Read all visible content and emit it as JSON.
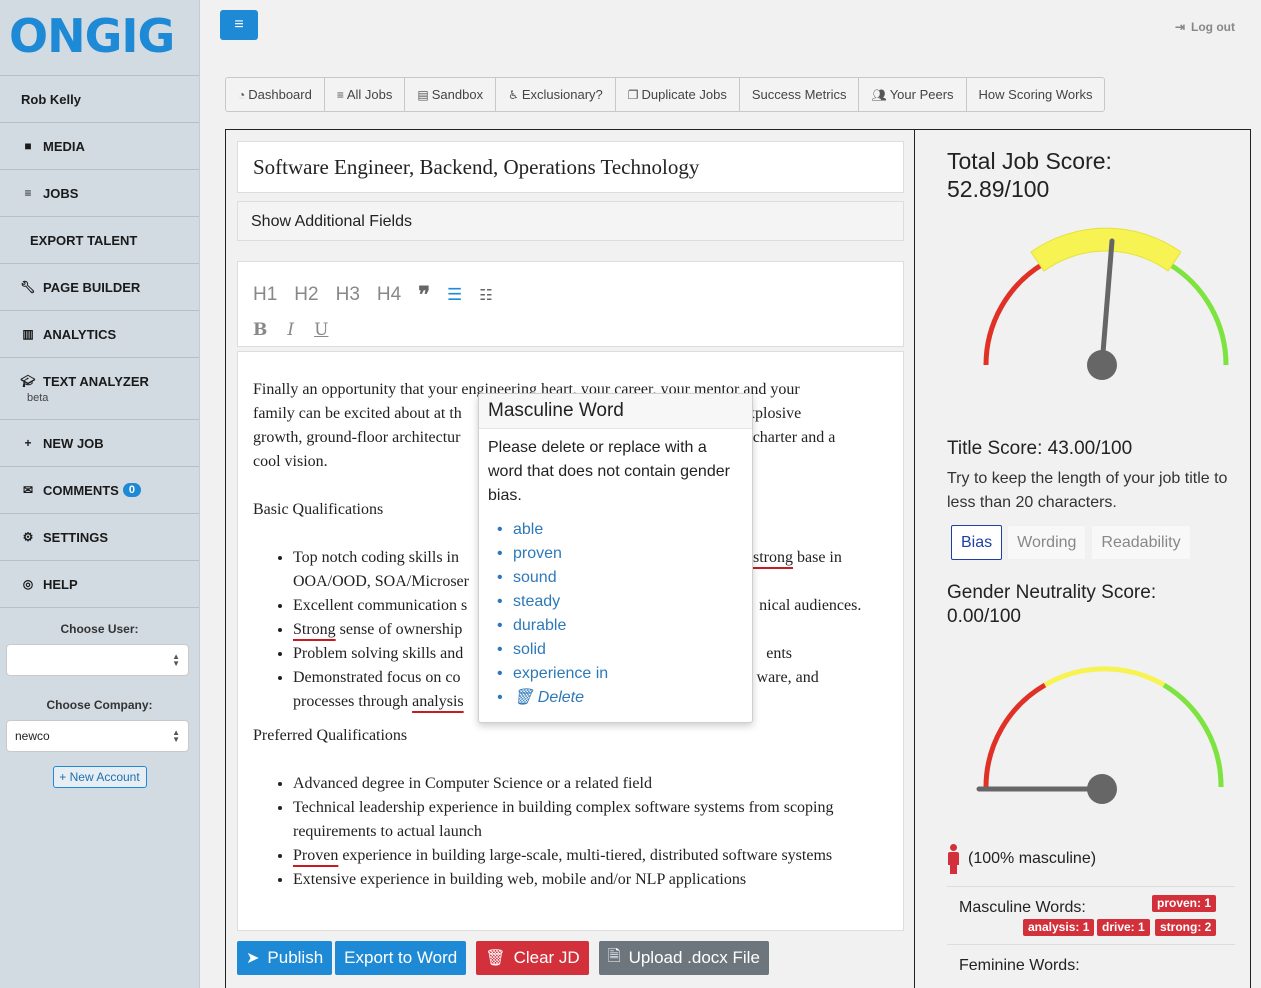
{
  "logo": "ONGIG",
  "sidebar": {
    "user_name": "Rob Kelly",
    "items": [
      {
        "label": "MEDIA",
        "icon": "video-camera-icon"
      },
      {
        "label": "JOBS",
        "icon": "list-icon"
      },
      {
        "label": "EXPORT TALENT",
        "icon": ""
      },
      {
        "label": "PAGE BUILDER",
        "icon": "wrench-icon"
      },
      {
        "label": "ANALYTICS",
        "icon": "bar-chart-icon"
      },
      {
        "label": "TEXT ANALYZER",
        "icon": "graduation-cap-icon",
        "sub": "beta"
      },
      {
        "label": "NEW JOB",
        "icon": "plus-icon"
      },
      {
        "label": "COMMENTS",
        "icon": "envelope-icon",
        "badge": "0"
      },
      {
        "label": "SETTINGS",
        "icon": "gear-icon"
      },
      {
        "label": "HELP",
        "icon": "life-ring-icon"
      }
    ],
    "choose_user_label": "Choose User:",
    "choose_user_value": "",
    "choose_company_label": "Choose Company:",
    "choose_company_value": "newco",
    "new_account_label": "New Account"
  },
  "header": {
    "logout_label": "Log out"
  },
  "nav": [
    {
      "label": "Dashboard",
      "icon": "dashboard-icon"
    },
    {
      "label": "All Jobs",
      "icon": "list-icon"
    },
    {
      "label": "Sandbox",
      "icon": "newspaper-icon"
    },
    {
      "label": "Exclusionary?",
      "icon": "wheelchair-icon"
    },
    {
      "label": "Duplicate Jobs",
      "icon": "copy-icon"
    },
    {
      "label": "Success Metrics",
      "icon": ""
    },
    {
      "label": "Your Peers",
      "icon": "users-icon"
    },
    {
      "label": "How Scoring Works",
      "icon": ""
    }
  ],
  "editor": {
    "job_title": "Software Engineer, Backend, Operations Technology",
    "additional_fields": "Show Additional Fields",
    "toolbar": {
      "h1": "H1",
      "h2": "H2",
      "h3": "H3",
      "h4": "H4",
      "bold": "B",
      "italic": "I",
      "underline": "U"
    },
    "intro_1": "Finally an opportunity that your engineering heart, your career, your mentor and your",
    "intro_2a": "family can be excited about at th",
    "intro_2b": "e., explosive",
    "intro_3a": "growth, ground-floor architectur",
    "intro_3b": "sible charter and a",
    "intro_4": "cool vision.",
    "basic_heading": "Basic Qualifications",
    "b1_a": "Top notch coding skills in ",
    "b1_b": "strong",
    "b1_c": " base in",
    "b1_d": "OOA/OOD, SOA/Microser",
    "b2_a": "Excellent communication s",
    "b2_b": "nical audiences.",
    "b3_a": "Strong",
    "b3_b": " sense of ownership",
    "b4_a": "Problem solving skills and",
    "b4_b": "ents",
    "b5_a": "Demonstrated focus on co",
    "b5_b": "ware, and",
    "b5_c": "processes through ",
    "b5_d": "analysis",
    "preferred_heading": "Preferred Qualifications",
    "p1": "Advanced degree in Computer Science or a related field",
    "p2": "Technical leadership experience in building complex software systems from scoping requirements to actual launch",
    "p3_a": "Proven",
    "p3_b": " experience in building large-scale, multi-tiered, distributed software systems",
    "p4": "Extensive experience in building web, mobile and/or NLP applications"
  },
  "buttons": {
    "publish": "Publish",
    "export": "Export to Word",
    "clear": "Clear JD",
    "upload": "Upload .docx File"
  },
  "popup": {
    "title": "Masculine Word",
    "message": "Please delete or replace with a word that does not contain gender bias.",
    "suggestions": [
      "able",
      "proven",
      "sound",
      "steady",
      "durable",
      "solid",
      "experience in"
    ],
    "delete_label": "Delete"
  },
  "score": {
    "total_label": "Total Job Score:",
    "total_value": "52.89/100",
    "total_numeric": 52.89,
    "title_score": "Title Score: 43.00/100",
    "title_hint": "Try to keep the length of your job title to less than 20 characters.",
    "tabs": [
      "Bias",
      "Wording",
      "Readability"
    ],
    "gender_label": "Gender Neutrality Score:",
    "gender_value": "0.00/100",
    "gender_numeric": 0,
    "masculine_pct": "(100% masculine)",
    "masculine_words_label": "Masculine Words:",
    "masculine_tags": [
      "proven: 1",
      "analysis: 1",
      "drive: 1",
      "strong: 2"
    ],
    "feminine_words_label": "Feminine Words:"
  },
  "colors": {
    "accent": "#1e8ad6",
    "danger": "#d2303a",
    "gauge_red": "#e03127",
    "gauge_yellow": "#f6f353",
    "gauge_green": "#7de33f"
  }
}
